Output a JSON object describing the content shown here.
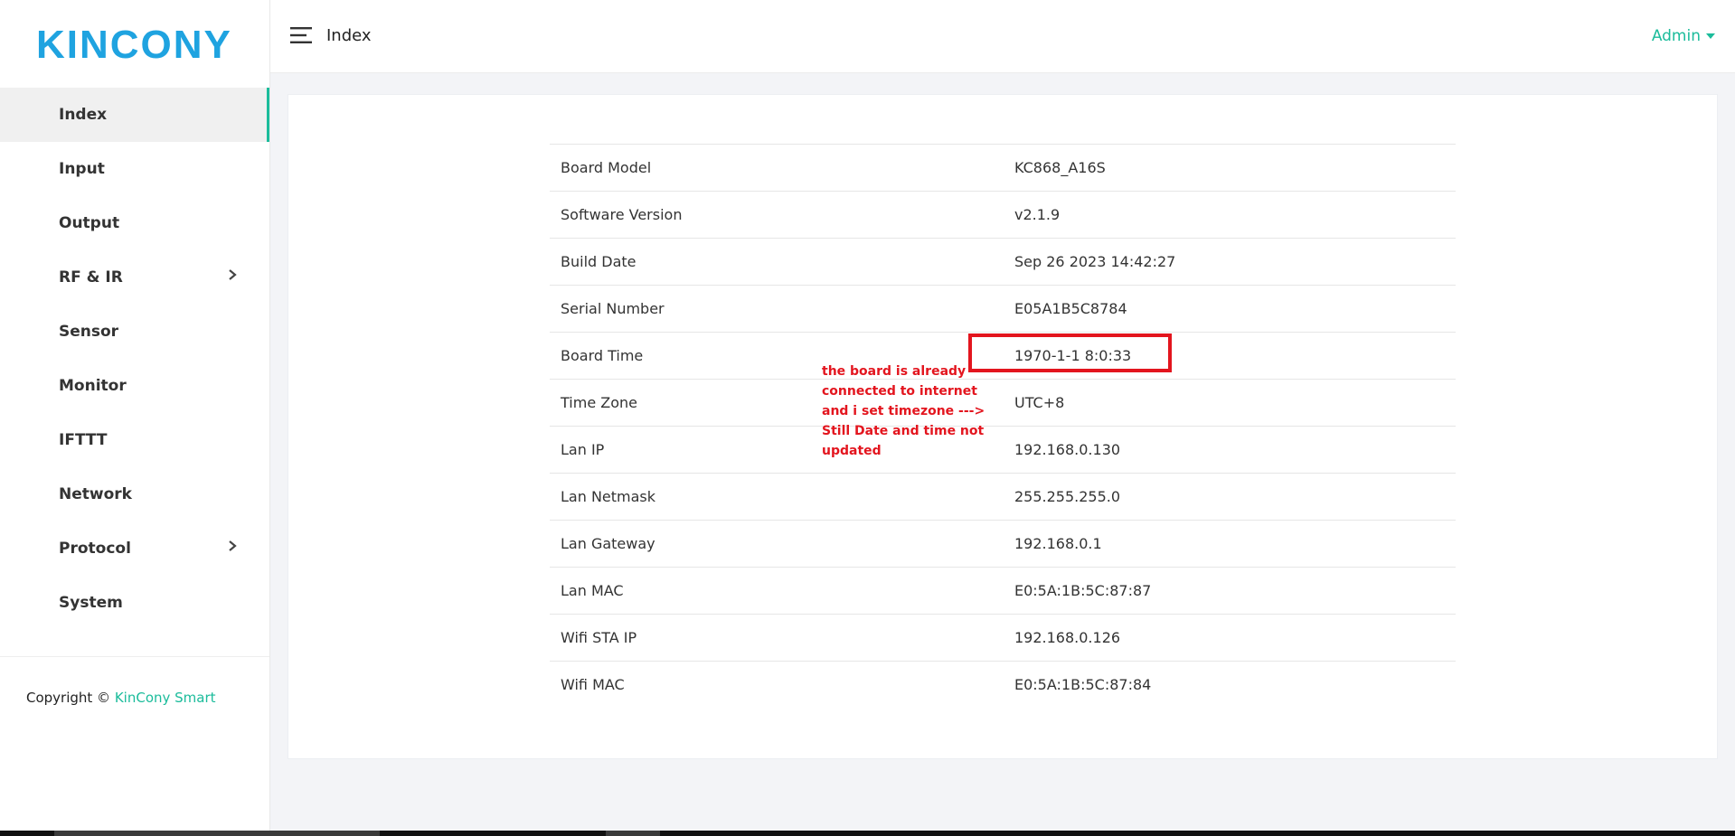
{
  "brand": {
    "logo_text": "KINCONY",
    "logo_color": "#1fa3e0"
  },
  "accent_color": "#1bbc9b",
  "sidebar": {
    "items": [
      {
        "label": "Index",
        "active": true,
        "has_submenu": false
      },
      {
        "label": "Input",
        "active": false,
        "has_submenu": false
      },
      {
        "label": "Output",
        "active": false,
        "has_submenu": false
      },
      {
        "label": "RF & IR",
        "active": false,
        "has_submenu": true
      },
      {
        "label": "Sensor",
        "active": false,
        "has_submenu": false
      },
      {
        "label": "Monitor",
        "active": false,
        "has_submenu": false
      },
      {
        "label": "IFTTT",
        "active": false,
        "has_submenu": false
      },
      {
        "label": "Network",
        "active": false,
        "has_submenu": false
      },
      {
        "label": "Protocol",
        "active": false,
        "has_submenu": true
      },
      {
        "label": "System",
        "active": false,
        "has_submenu": false
      }
    ],
    "copyright_prefix": "Copyright ©",
    "copyright_brand": "KinCony Smart"
  },
  "header": {
    "title": "Index",
    "user_menu": "Admin"
  },
  "info_table": [
    {
      "key": "Board Model",
      "value": "KC868_A16S"
    },
    {
      "key": "Software Version",
      "value": "v2.1.9"
    },
    {
      "key": "Build Date",
      "value": "Sep 26 2023 14:42:27"
    },
    {
      "key": "Serial Number",
      "value": "E05A1B5C8784"
    },
    {
      "key": "Board Time",
      "value": "1970-1-1 8:0:33"
    },
    {
      "key": "Time Zone",
      "value": "UTC+8"
    },
    {
      "key": "Lan IP",
      "value": "192.168.0.130"
    },
    {
      "key": "Lan Netmask",
      "value": "255.255.255.0"
    },
    {
      "key": "Lan Gateway",
      "value": "192.168.0.1"
    },
    {
      "key": "Lan MAC",
      "value": "E0:5A:1B:5C:87:87"
    },
    {
      "key": "Wifi STA IP",
      "value": "192.168.0.126"
    },
    {
      "key": "Wifi MAC",
      "value": "E0:5A:1B:5C:87:84"
    }
  ],
  "annotation": {
    "text": "the board is already\nconnected to internet\nand i set timezone  --->\nStill Date and time not\nupdated",
    "color": "#e3151e"
  }
}
